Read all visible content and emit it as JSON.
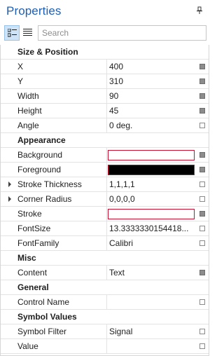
{
  "header": {
    "title": "Properties"
  },
  "toolbar": {
    "search_placeholder": "Search"
  },
  "colors": {
    "title": "#1e5fb4",
    "swatch_border": "#c8102e",
    "background_swatch": "#ffffff",
    "foreground_swatch": "#000000",
    "stroke_swatch": "#ffffff"
  },
  "categories": {
    "size_position": {
      "label": "Size & Position"
    },
    "appearance": {
      "label": "Appearance"
    },
    "misc": {
      "label": "Misc"
    },
    "general": {
      "label": "General"
    },
    "symbol_values": {
      "label": "Symbol Values"
    }
  },
  "props": {
    "x": {
      "name": "X",
      "value": "400"
    },
    "y": {
      "name": "Y",
      "value": "310"
    },
    "width": {
      "name": "Width",
      "value": "90"
    },
    "height": {
      "name": "Height",
      "value": "45"
    },
    "angle": {
      "name": "Angle",
      "value": "0 deg."
    },
    "background": {
      "name": "Background"
    },
    "foreground": {
      "name": "Foreground"
    },
    "stroke_thickness": {
      "name": "Stroke Thickness",
      "value": "1,1,1,1"
    },
    "corner_radius": {
      "name": "Corner Radius",
      "value": "0,0,0,0"
    },
    "stroke": {
      "name": "Stroke"
    },
    "fontsize": {
      "name": "FontSize",
      "value": "13.3333330154418..."
    },
    "fontfamily": {
      "name": "FontFamily",
      "value": "Calibri"
    },
    "content": {
      "name": "Content",
      "value": "Text"
    },
    "control_name": {
      "name": "Control Name",
      "value": ""
    },
    "symbol_filter": {
      "name": "Symbol Filter",
      "value": "Signal"
    },
    "value": {
      "name": "Value",
      "value": ""
    }
  }
}
